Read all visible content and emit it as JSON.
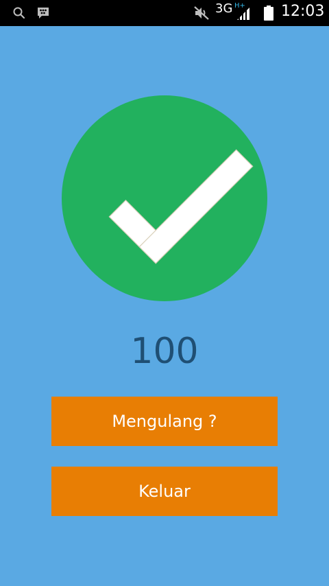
{
  "status_bar": {
    "network": "3G",
    "network_sub": "H+",
    "time": "12:03",
    "icons": [
      "search-icon",
      "bbm-icon",
      "mute-icon",
      "signal-icon",
      "battery-icon"
    ]
  },
  "result": {
    "icon": "check-circle-icon",
    "score": "100"
  },
  "buttons": {
    "retry_label": "Mengulang ?",
    "exit_label": "Keluar"
  },
  "colors": {
    "background": "#5aa9e3",
    "check_circle": "#22b15e",
    "button": "#e87e04",
    "score_text": "#1f4f74"
  }
}
